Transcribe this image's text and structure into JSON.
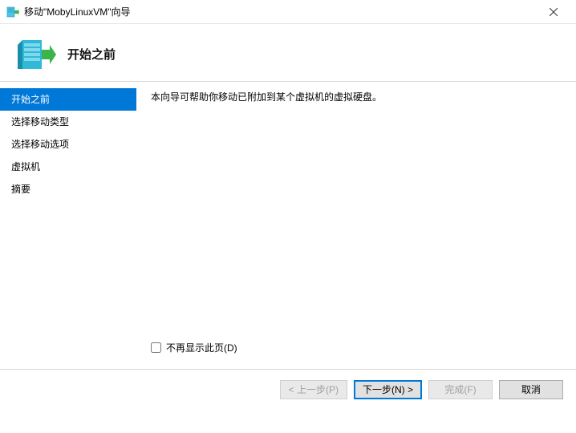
{
  "window": {
    "title": "移动\"MobyLinuxVM\"向导"
  },
  "header": {
    "title": "开始之前"
  },
  "sidebar": {
    "items": [
      {
        "label": "开始之前",
        "selected": true
      },
      {
        "label": "选择移动类型",
        "selected": false
      },
      {
        "label": "选择移动选项",
        "selected": false
      },
      {
        "label": "虚拟机",
        "selected": false
      },
      {
        "label": "摘要",
        "selected": false
      }
    ]
  },
  "content": {
    "description": "本向导可帮助你移动已附加到某个虚拟机的虚拟硬盘。",
    "checkbox_label": "不再显示此页(D)",
    "checkbox_checked": false
  },
  "footer": {
    "prev": "< 上一步(P)",
    "next": "下一步(N) >",
    "finish": "完成(F)",
    "cancel": "取消"
  }
}
